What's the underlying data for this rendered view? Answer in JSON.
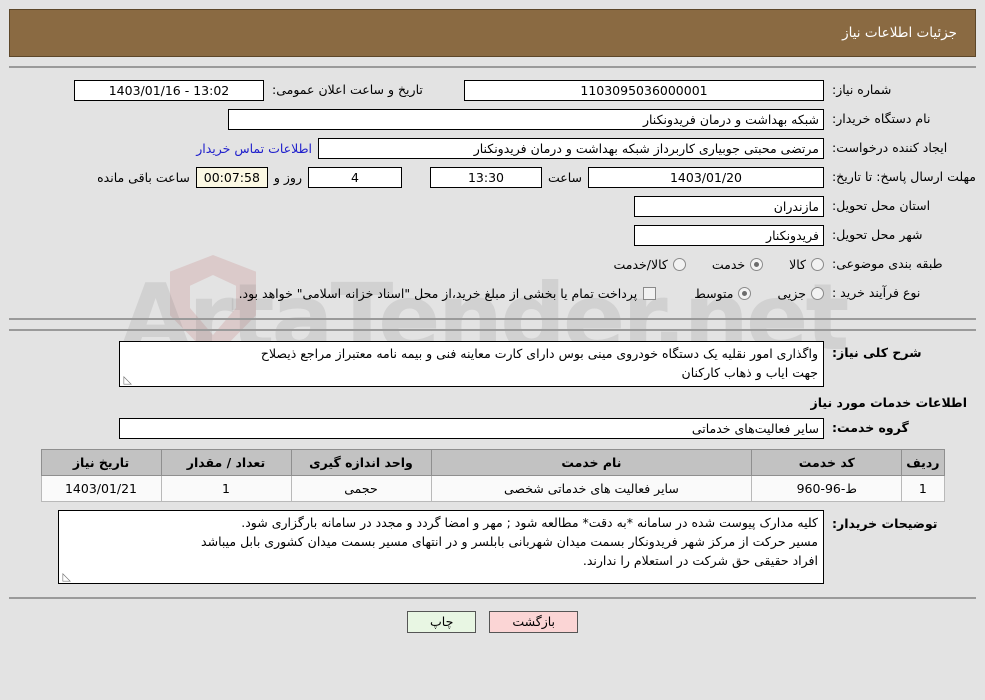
{
  "header": {
    "title": "جزئیات اطلاعات نیاز"
  },
  "watermark": {
    "text": "ArtaTender.net"
  },
  "form": {
    "need_number_label": "شماره نیاز:",
    "need_number_value": "1103095036000001",
    "public_announce_label": "تاریخ و ساعت اعلان عمومی:",
    "public_announce_value": "13:02 - 1403/01/16",
    "buyer_org_label": "نام دستگاه خریدار:",
    "buyer_org_value": "شبکه بهداشت و درمان فریدونکنار",
    "creator_label": "ایجاد کننده درخواست:",
    "creator_value": "مرتضی محبتی جوبیاری کاربرداز شبکه بهداشت و درمان فریدونکنار",
    "contact_link": "اطلاعات تماس خریدار",
    "deadline_label": "مهلت ارسال پاسخ: تا تاریخ:",
    "deadline_date": "1403/01/20",
    "deadline_hour_label": "ساعت",
    "deadline_hour_value": "13:30",
    "days_left_value": "4",
    "days_left_label": "روز و",
    "timer_value": "00:07:58",
    "timer_label": "ساعت باقی مانده",
    "province_label": "استان محل تحویل:",
    "province_value": "مازندران",
    "city_label": "شهر محل تحویل:",
    "city_value": "فریدونکنار",
    "category_label": "طبقه بندی موضوعی:",
    "category_options": [
      {
        "label": "کالا",
        "selected": false
      },
      {
        "label": "خدمت",
        "selected": true
      },
      {
        "label": "کالا/خدمت",
        "selected": false
      }
    ],
    "process_label": "نوع فرآیند خرید :",
    "process_options": [
      {
        "label": "جزیی",
        "selected": false
      },
      {
        "label": "متوسط",
        "selected": true
      }
    ],
    "treasury_checkbox_label": "پرداخت تمام یا بخشی از مبلغ خرید،از محل \"اسناد خزانه اسلامی\" خواهد بود.",
    "treasury_checked": false
  },
  "description": {
    "label": "شرح کلی نیاز:",
    "line1": "واگذاری امور نقلیه یک دستگاه خودروی مینی بوس دارای کارت معاینه فنی و بیمه نامه معتبراز مراجع ذیصلاح",
    "line2": "جهت ایاب و ذهاب کارکنان"
  },
  "services": {
    "section_title": "اطلاعات خدمات مورد نیاز",
    "group_label": "گروه خدمت:",
    "group_value": "سایر فعالیت‌های خدماتی",
    "table": {
      "headers": [
        "ردیف",
        "کد خدمت",
        "نام خدمت",
        "واحد اندازه گیری",
        "تعداد / مقدار",
        "تاریخ نیاز"
      ],
      "rows": [
        [
          "1",
          "ط-96-960",
          "سایر فعالیت های خدماتی شخصی",
          "حجمی",
          "1",
          "1403/01/21"
        ]
      ]
    }
  },
  "notes": {
    "label": "توضیحات خریدار:",
    "line1": "کلیه مدارک پیوست شده در سامانه *به دقت* مطالعه شود ; مهر و امضا گردد و مجدد در سامانه بارگزاری شود.",
    "line2": "مسیر حرکت از مرکز شهر فریدونکار بسمت میدان شهربانی بابلسر و در انتهای مسیر بسمت میدان کشوری بابل میباشد",
    "line3": "افراد حقیقی حق شرکت در استعلام را ندارند."
  },
  "footer": {
    "back_label": "بازگشت",
    "print_label": "چاپ"
  }
}
